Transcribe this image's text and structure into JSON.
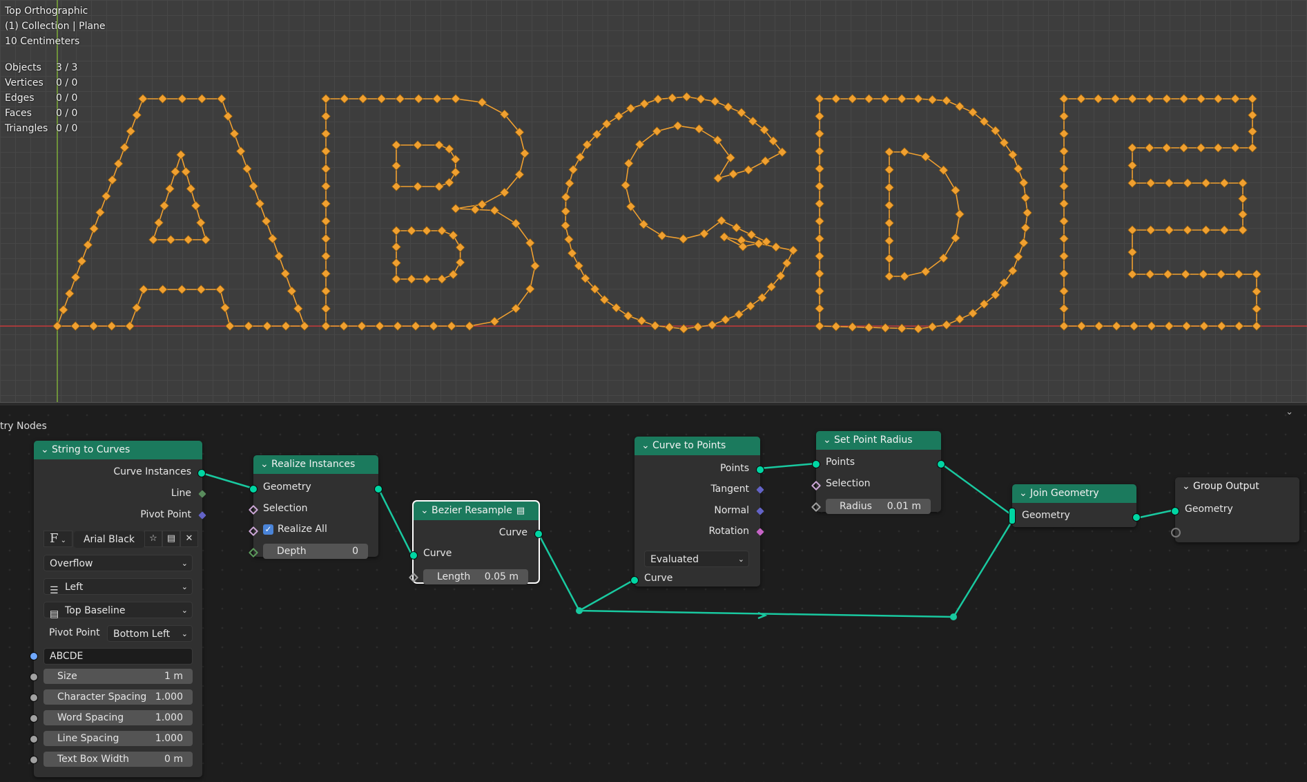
{
  "viewport": {
    "view_name": "Top Orthographic",
    "collection": "(1) Collection | Plane",
    "scale": "10 Centimeters",
    "stats": [
      {
        "label": "Objects",
        "value": "3 / 3"
      },
      {
        "label": "Vertices",
        "value": "0 / 0"
      },
      {
        "label": "Edges",
        "value": "0 / 0"
      },
      {
        "label": "Faces",
        "value": "0 / 0"
      },
      {
        "label": "Triangles",
        "value": "0 / 0"
      }
    ],
    "point_color": "#f0a030"
  },
  "editor": {
    "title": "try Nodes",
    "wire_color": "#19c9a0",
    "header_color": "#1b7a5d"
  },
  "nodes": {
    "string_to_curves": {
      "title": "String to Curves",
      "out_curve_instances": "Curve Instances",
      "out_line": "Line",
      "out_pivot_point": "Pivot Point",
      "font_icon": "F",
      "font_name": "Arial Black",
      "overflow": "Overflow",
      "align_x": "Left",
      "align_y": "Top Baseline",
      "pivot_label": "Pivot Point",
      "pivot_value": "Bottom Left",
      "string": "ABCDE",
      "size_label": "Size",
      "size_value": "1 m",
      "char_spacing_label": "Character Spacing",
      "char_spacing_value": "1.000",
      "word_spacing_label": "Word Spacing",
      "word_spacing_value": "1.000",
      "line_spacing_label": "Line Spacing",
      "line_spacing_value": "1.000",
      "text_box_label": "Text Box Width",
      "text_box_value": "0 m"
    },
    "realize_instances": {
      "title": "Realize Instances",
      "in_geometry": "Geometry",
      "in_selection": "Selection",
      "realize_all": "Realize All",
      "depth_label": "Depth",
      "depth_value": "0"
    },
    "bezier_resample": {
      "title": "Bezier Resample",
      "out_curve": "Curve",
      "in_curve": "Curve",
      "length_label": "Length",
      "length_value": "0.05 m"
    },
    "curve_to_points": {
      "title": "Curve to Points",
      "out_points": "Points",
      "out_tangent": "Tangent",
      "out_normal": "Normal",
      "out_rotation": "Rotation",
      "mode": "Evaluated",
      "in_curve": "Curve"
    },
    "set_point_radius": {
      "title": "Set Point Radius",
      "in_points": "Points",
      "in_selection": "Selection",
      "radius_label": "Radius",
      "radius_value": "0.01 m"
    },
    "join_geometry": {
      "title": "Join Geometry",
      "in_geometry": "Geometry"
    },
    "group_output": {
      "title": "Group Output",
      "in_geometry": "Geometry"
    }
  }
}
